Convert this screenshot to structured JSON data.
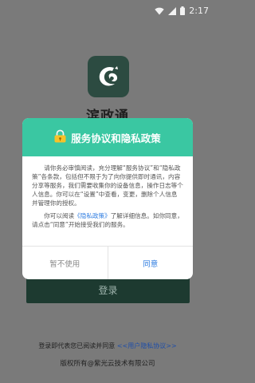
{
  "status_bar": {
    "time": "2:17",
    "icons": [
      "wifi-icon",
      "signal-icon",
      "battery-icon"
    ]
  },
  "app": {
    "name": "滨政通",
    "logo_icon": "app-logo-icon"
  },
  "login": {
    "button_label": "登录"
  },
  "footer": {
    "agree_prefix": "登录即代表您已阅读并同意 ",
    "agree_link": "<<用户隐私协议>>",
    "copyright": "版权所有@紫光云技术有限公司"
  },
  "dialog": {
    "title": "服务协议和隐私政策",
    "title_icon": "lock-icon",
    "paragraph1": "请你务必审慎阅读，充分理解“服务协议”和“隐私政策”各条款，包括但不限于为了向你提供即时通讯，内容分享等服务，我们需要收集你的设备信息，操作日志等个人信息。你可以在“设置”中查看，变更，删除个人信息并管理你的授权。",
    "paragraph2_prefix": "你可以阅读",
    "paragraph2_link": "《隐私政策》",
    "paragraph2_suffix": "了解详细信息。如你同意，请点击“同意”开始接受我们的服务。",
    "cancel_label": "暂不使用",
    "agree_label": "同意"
  },
  "colors": {
    "header_green": "#3ac7a2",
    "login_button": "#1d3a30",
    "link_blue": "#2f7de1",
    "overlay": "#7a7a7a"
  }
}
